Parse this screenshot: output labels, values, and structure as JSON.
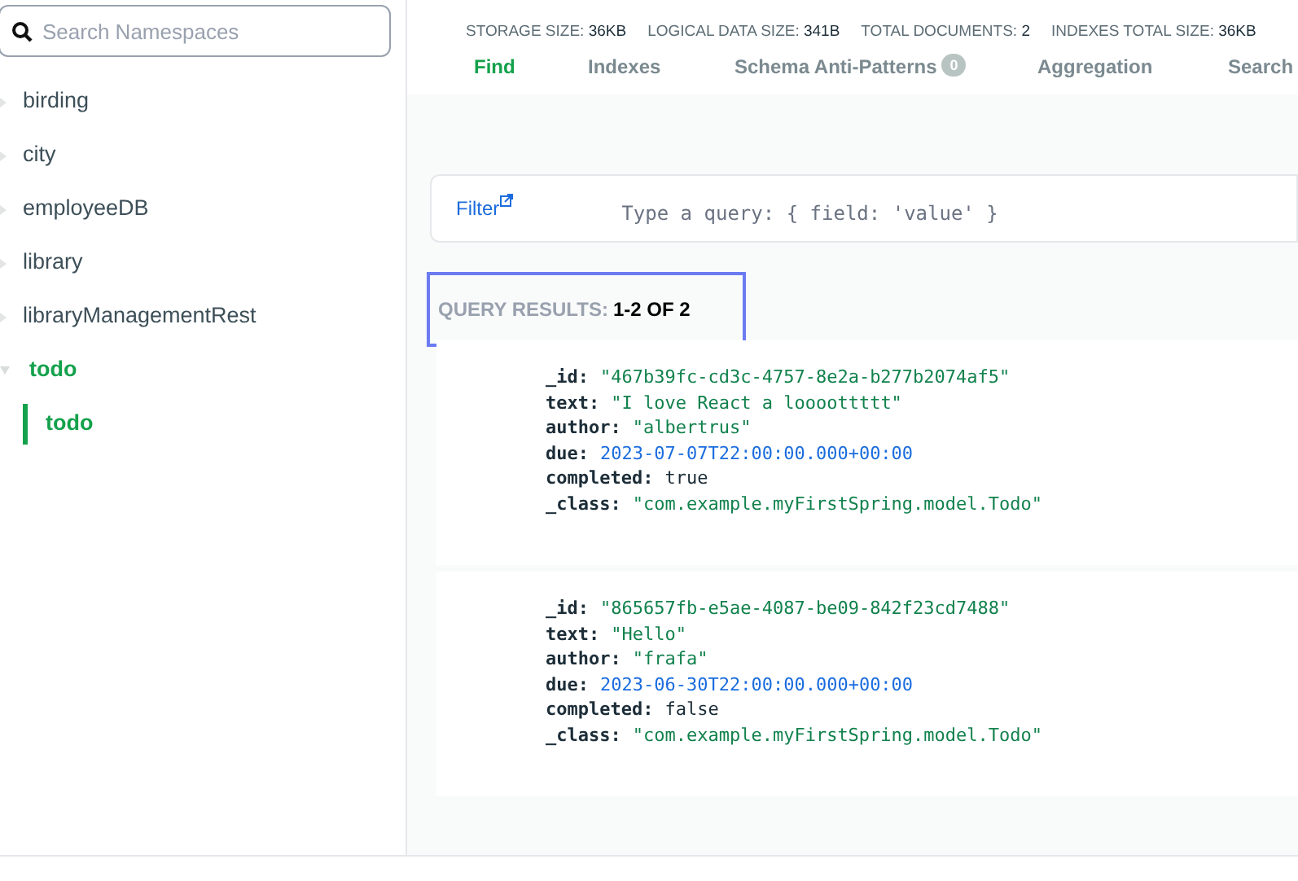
{
  "sidebar": {
    "search": {
      "placeholder": "Search Namespaces"
    },
    "items": [
      {
        "label": "birding",
        "expanded": false,
        "selected": false
      },
      {
        "label": "city",
        "expanded": false,
        "selected": false
      },
      {
        "label": "employeeDB",
        "expanded": false,
        "selected": false
      },
      {
        "label": "library",
        "expanded": false,
        "selected": false
      },
      {
        "label": "libraryManagementRest",
        "expanded": false,
        "selected": false
      },
      {
        "label": "todo",
        "expanded": true,
        "selected": false,
        "children": [
          {
            "label": "todo",
            "selected": true
          }
        ]
      }
    ]
  },
  "stats": [
    {
      "label": "STORAGE SIZE:",
      "value": "36KB"
    },
    {
      "label": "LOGICAL DATA SIZE:",
      "value": "341B"
    },
    {
      "label": "TOTAL DOCUMENTS:",
      "value": "2"
    },
    {
      "label": "INDEXES TOTAL SIZE:",
      "value": "36KB"
    }
  ],
  "tabs": [
    {
      "label": "Find",
      "selected": true
    },
    {
      "label": "Indexes",
      "selected": false
    },
    {
      "label": "Schema Anti-Patterns",
      "badge": "0",
      "selected": false
    },
    {
      "label": "Aggregation",
      "selected": false
    },
    {
      "label": "Search",
      "selected": false
    }
  ],
  "filter": {
    "label": "Filter",
    "placeholder": "Type a query: { field: 'value' }"
  },
  "results": {
    "label": "QUERY RESULTS:",
    "value": "1-2 OF 2"
  },
  "documents": [
    {
      "fields": [
        {
          "key": "_id:",
          "value": "\"467b39fc-cd3c-4757-8e2a-b277b2074af5\"",
          "kind": "string"
        },
        {
          "key": "text:",
          "value": "\"I love React a loooottttt\"",
          "kind": "string"
        },
        {
          "key": "author:",
          "value": "\"albertrus\"",
          "kind": "string"
        },
        {
          "key": "due:",
          "value": "2023-07-07T22:00:00.000+00:00",
          "kind": "date"
        },
        {
          "key": "completed:",
          "value": "true",
          "kind": "boolean"
        },
        {
          "key": "_class:",
          "value": "\"com.example.myFirstSpring.model.Todo\"",
          "kind": "string"
        }
      ]
    },
    {
      "fields": [
        {
          "key": "_id:",
          "value": "\"865657fb-e5ae-4087-be09-842f23cd7488\"",
          "kind": "string"
        },
        {
          "key": "text:",
          "value": "\"Hello\"",
          "kind": "string"
        },
        {
          "key": "author:",
          "value": "\"frafa\"",
          "kind": "string"
        },
        {
          "key": "due:",
          "value": "2023-06-30T22:00:00.000+00:00",
          "kind": "date"
        },
        {
          "key": "completed:",
          "value": "false",
          "kind": "boolean"
        },
        {
          "key": "_class:",
          "value": "\"com.example.myFirstSpring.model.Todo\"",
          "kind": "string"
        }
      ]
    }
  ]
}
